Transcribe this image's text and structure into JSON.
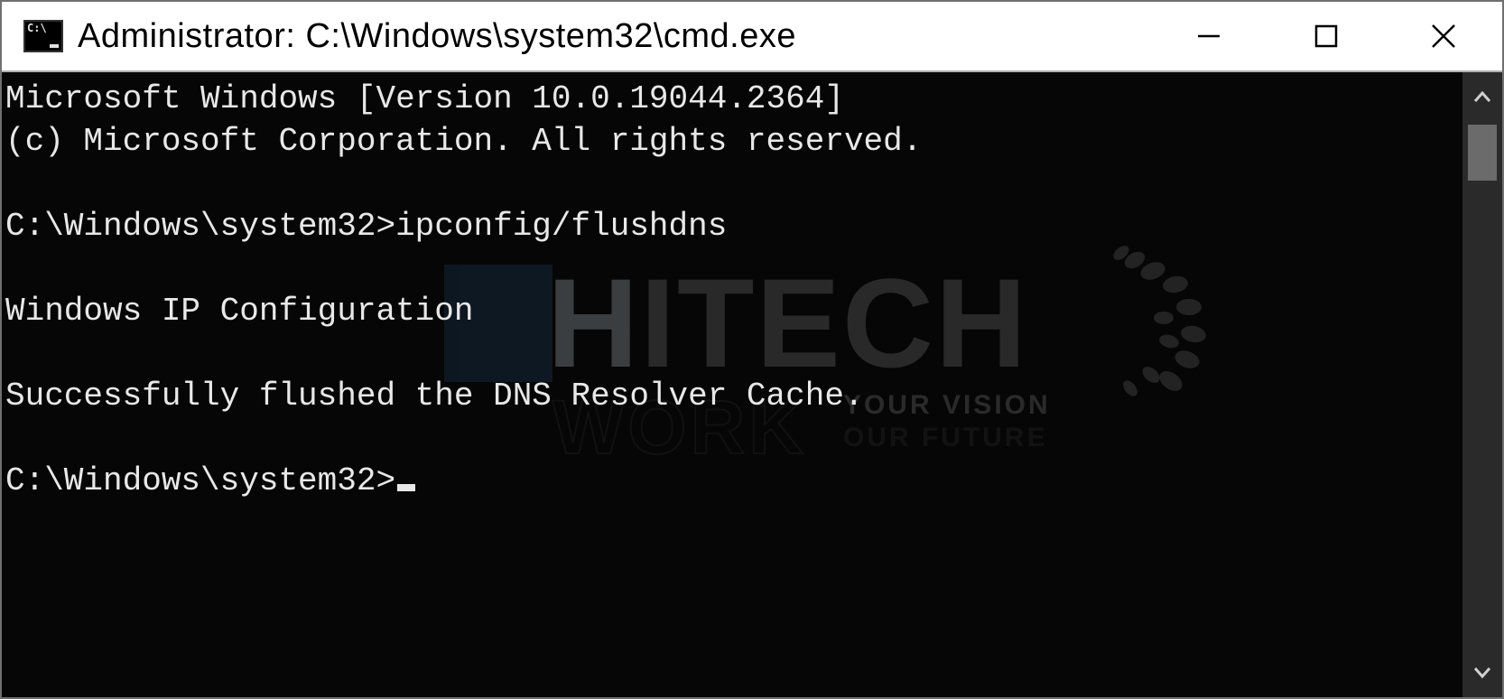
{
  "window": {
    "title": "Administrator: C:\\Windows\\system32\\cmd.exe"
  },
  "terminal": {
    "line_version": "Microsoft Windows [Version 10.0.19044.2364]",
    "line_copyright": "(c) Microsoft Corporation. All rights reserved.",
    "blank1": "",
    "line_cmd": "C:\\Windows\\system32>ipconfig/flushdns",
    "blank2": "",
    "line_ipcfg": "Windows IP Configuration",
    "blank3": "",
    "line_success": "Successfully flushed the DNS Resolver Cache.",
    "blank4": "",
    "line_prompt": "C:\\Windows\\system32>"
  },
  "watermark": {
    "brand": "HITECH",
    "sub": "WORK",
    "tag1": "YOUR VISION",
    "tag2": "OUR FUTURE"
  }
}
